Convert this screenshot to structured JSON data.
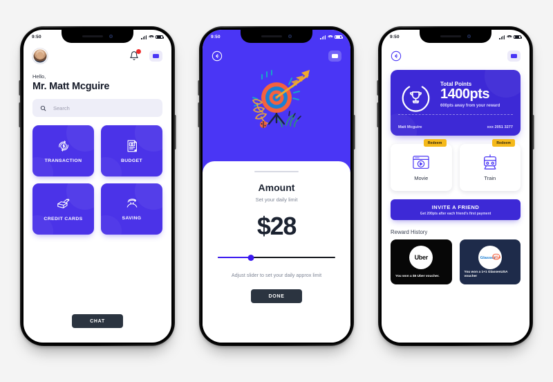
{
  "phones": {
    "home": {
      "status": {
        "time": "9:50"
      },
      "header": {
        "avatar": "user-avatar",
        "bell": "notification-bell",
        "menu": "menu-button"
      },
      "greeting": "Hello,",
      "username": "Mr. Matt Mcguire",
      "search": {
        "placeholder": "Search"
      },
      "tiles": [
        {
          "label": "TRANSACTION",
          "icon": "money-cycle-icon"
        },
        {
          "label": "BUDGET",
          "icon": "budget-document-icon"
        },
        {
          "label": "CREDIT CARDS",
          "icon": "credit-card-hand-icon"
        },
        {
          "label": "SAVING",
          "icon": "piggy-saving-icon"
        }
      ],
      "chat_label": "CHAT"
    },
    "amount": {
      "status": {
        "time": "9:50"
      },
      "header": {
        "back": "back-button",
        "menu": "menu-button"
      },
      "illustration": "target-arrow-illustration",
      "title": "Amount",
      "subtitle": "Set your daily limit",
      "value": "$28",
      "slider": {
        "percent": 28
      },
      "helper": "Adjust slider to set your daily approx limit",
      "done_label": "DONE"
    },
    "rewards": {
      "status": {
        "time": "9:50"
      },
      "header": {
        "back": "back-button",
        "menu": "menu-button"
      },
      "points_card": {
        "label": "Total Points",
        "value": "1400pts",
        "note": "600pts away from your reward",
        "holder": "Matt Mcguire",
        "account": "xxx 2051 3277",
        "icon": "trophy-icon"
      },
      "redeem_badge": "Redeem",
      "redeem_items": [
        {
          "label": "Movie",
          "icon": "movie-player-icon"
        },
        {
          "label": "Train",
          "icon": "train-icon"
        }
      ],
      "invite": {
        "title": "INVITE A FRIEND",
        "subtitle": "Get 200pts after each friend's first payment"
      },
      "history_title": "Reward History",
      "history": [
        {
          "brand": "Uber",
          "caption": "You won a $5 Uber voucher."
        },
        {
          "brand": "GlassesUSA",
          "caption": "You won a 1+1 GlassesUSA voucher"
        }
      ]
    }
  },
  "colors": {
    "primary": "#4a36f5",
    "tile": "#4b33e8",
    "card": "#3d29d6",
    "dark": "#2b3440",
    "amber": "#f5b91a",
    "page_bg": "#f4f4f4"
  }
}
